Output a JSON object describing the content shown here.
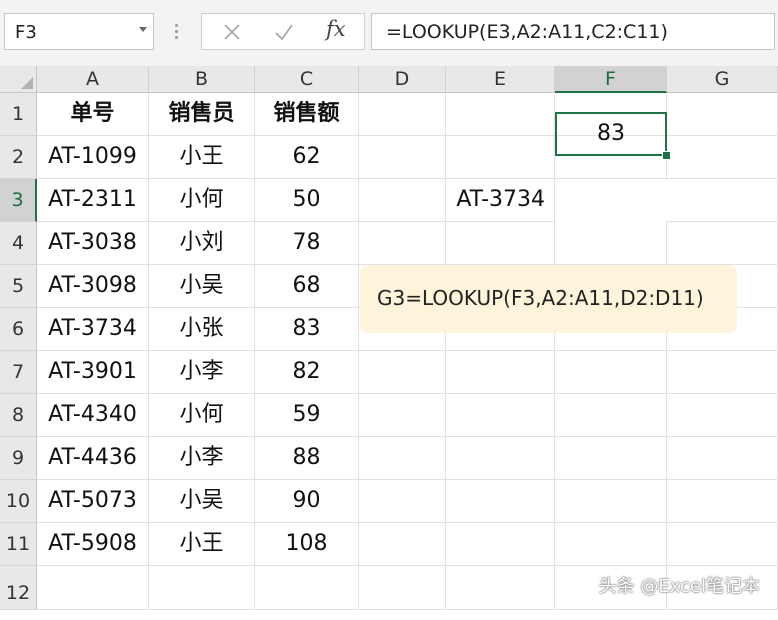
{
  "name_box": {
    "value": "F3"
  },
  "formula_bar": {
    "cancel_icon": "close-icon",
    "enter_icon": "check-icon",
    "function_icon": "fx-icon",
    "fx_label": "fx",
    "formula": "=LOOKUP(E3,A2:A11,C2:C11)"
  },
  "columns": [
    "A",
    "B",
    "C",
    "D",
    "E",
    "F",
    "G"
  ],
  "selected_column": "F",
  "rows": [
    "1",
    "2",
    "3",
    "4",
    "5",
    "6",
    "7",
    "8",
    "9",
    "10",
    "11",
    "12"
  ],
  "selected_row": "3",
  "table": {
    "headers": [
      "单号",
      "销售员",
      "销售额"
    ],
    "data": [
      [
        "AT-1099",
        "小王",
        "62"
      ],
      [
        "AT-2311",
        "小何",
        "50"
      ],
      [
        "AT-3038",
        "小刘",
        "78"
      ],
      [
        "AT-3098",
        "小吴",
        "68"
      ],
      [
        "AT-3734",
        "小张",
        "83"
      ],
      [
        "AT-3901",
        "小李",
        "82"
      ],
      [
        "AT-4340",
        "小何",
        "59"
      ],
      [
        "AT-4436",
        "小李",
        "88"
      ],
      [
        "AT-5073",
        "小吴",
        "90"
      ],
      [
        "AT-5908",
        "小王",
        "108"
      ]
    ]
  },
  "lookup": {
    "key": "AT-3734",
    "result": "83"
  },
  "note": "G3=LOOKUP(F3,A2:A11,D2:D11)",
  "watermark": "头条 @Excel笔记本",
  "colors": {
    "accent": "#217346",
    "note_bg": "#fdf4db",
    "header_bg": "#e8e8e8"
  }
}
